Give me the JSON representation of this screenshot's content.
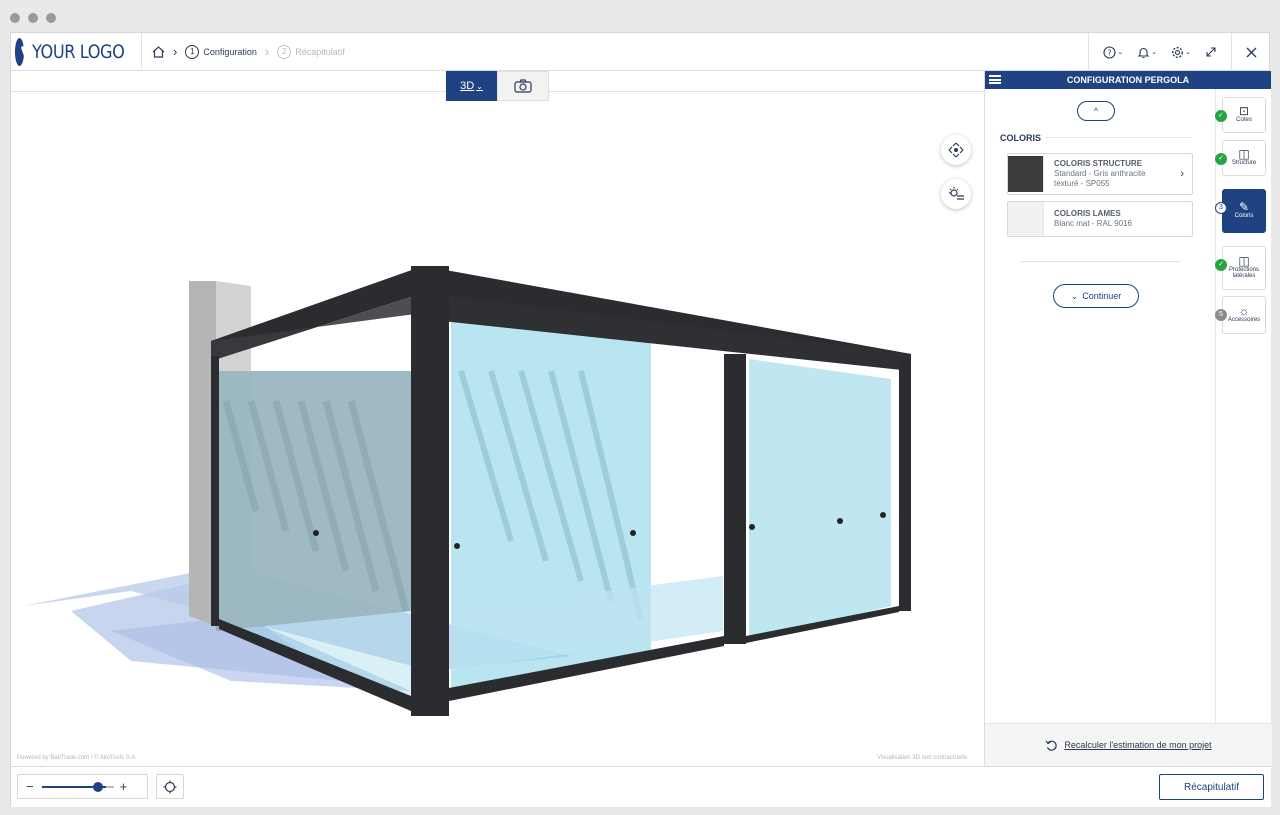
{
  "app": {
    "logo_text": "YOUR LOGO",
    "accent_color": "#1f4283"
  },
  "breadcrumb": {
    "step1_num": "1",
    "step1_label": "Configuration",
    "step2_num": "2",
    "step2_label": "Récapitulatif"
  },
  "header_icons": [
    "home-icon",
    "help-icon",
    "bell-icon",
    "gear-icon",
    "expand-icon",
    "close-icon"
  ],
  "viewer": {
    "tab_3d_label": "3D",
    "footer_left": "Powered by BatiTrade.com / © AlloTools S.A.",
    "footer_right": "Visualisation 3D non contractuelle"
  },
  "panel": {
    "title": "CONFIGURATION PERGOLA",
    "section_title": "COLORIS",
    "options": [
      {
        "title": "COLORIS STRUCTURE",
        "line1": "Standard - Gris anthracite",
        "line2": "texturé - SP055",
        "swatch": "#3a3b3d"
      },
      {
        "title": "COLORIS LAMES",
        "line1": "Blanc mat - RAL 9016",
        "line2": "",
        "swatch": "#f1f1f0"
      }
    ],
    "continue_label": "Continuer",
    "recalc_label": "Recalculer l'estimation de mon projet"
  },
  "steps": [
    {
      "label": "Cotes",
      "status": "done",
      "badge": ""
    },
    {
      "label": "Structure",
      "status": "done",
      "badge": ""
    },
    {
      "label": "Coloris",
      "status": "current",
      "badge": "3"
    },
    {
      "label": "Protections latérales",
      "status": "done",
      "badge": ""
    },
    {
      "label": "Accessoires",
      "status": "todo",
      "badge": "5"
    }
  ],
  "bottombar": {
    "zoom_minus": "−",
    "zoom_plus": "+",
    "zoom_level": 0.8,
    "recap_label": "Récapitulatif"
  }
}
